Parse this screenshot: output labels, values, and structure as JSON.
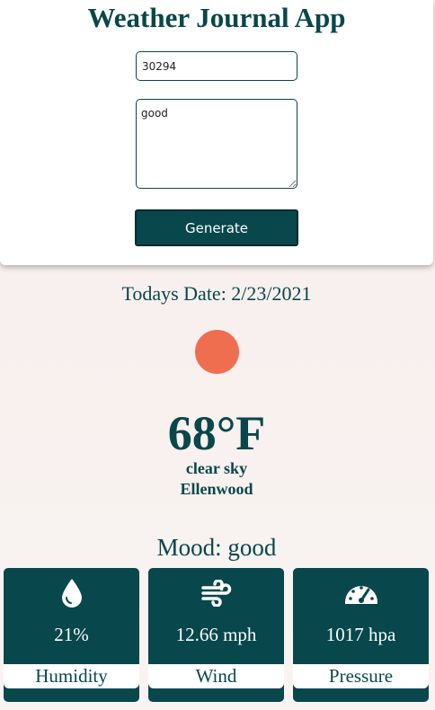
{
  "app": {
    "title": "Weather Journal App"
  },
  "form": {
    "zip_value": "30294",
    "feelings_value": "good",
    "generate_label": "Generate"
  },
  "entry": {
    "date_line": "Todays Date: 2/23/2021",
    "temperature": "68°F",
    "description": "clear sky",
    "city": "Ellenwood",
    "mood_line": "Mood: good"
  },
  "stats": [
    {
      "icon": "droplet-icon",
      "value": "21%",
      "label": "Humidity"
    },
    {
      "icon": "wind-icon",
      "value": "12.66 mph",
      "label": "Wind"
    },
    {
      "icon": "gauge-icon",
      "value": "1017 hpa",
      "label": "Pressure"
    }
  ],
  "colors": {
    "primary": "#08474c",
    "sun": "#ee6e4f",
    "background": "#f6eeeb"
  }
}
